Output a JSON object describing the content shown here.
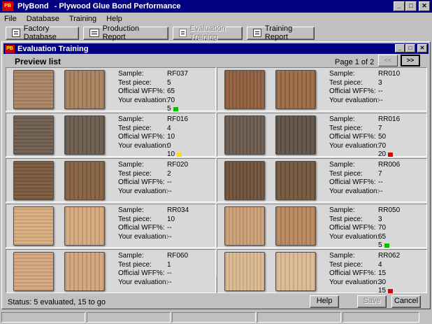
{
  "app": {
    "icon_text": "PB",
    "title_name": "PlyBond",
    "title_rest": "- Plywood Glue Bond Performance"
  },
  "window_buttons": {
    "minimize": "_",
    "maximize": "□",
    "close": "✕"
  },
  "menu": [
    "File",
    "Database",
    "Training",
    "Help"
  ],
  "toolbar": [
    {
      "label": "Factory Database",
      "icon": "database-icon",
      "disabled": false
    },
    {
      "label": "Production Report",
      "icon": "report-icon",
      "disabled": false
    },
    {
      "label": "Evaluation Training",
      "icon": "training-icon",
      "disabled": true
    },
    {
      "label": "Training Report",
      "icon": "printer-icon",
      "disabled": false
    }
  ],
  "child_window": {
    "icon_text": "PB",
    "title": "Evaluation Training",
    "preview_label": "Preview list",
    "page_indicator": "Page 1 of 2",
    "prev_label": "<<",
    "next_label": ">>"
  },
  "field_labels": {
    "sample": "Sample:",
    "test_piece": "Test piece:",
    "official_wff": "Official WFF%:",
    "your_evaluation": "Your evaluation:"
  },
  "cards": [
    {
      "sample": "RF037",
      "test_piece": "5",
      "official_wff": "65",
      "your_evaluation": "70",
      "score": "5",
      "indicator_color": "#00c000",
      "wood_a": "#a98461",
      "wood_b": "#a67f5c"
    },
    {
      "sample": "RR010",
      "test_piece": "3",
      "official_wff": "--",
      "your_evaluation": "--",
      "score": "",
      "indicator_color": "",
      "wood_a": "#8f5e3d",
      "wood_b": "#9a6a45"
    },
    {
      "sample": "RF016",
      "test_piece": "4",
      "official_wff": "10",
      "your_evaluation": "0",
      "score": "10",
      "indicator_color": "#ffe000",
      "wood_a": "#6e5e4e",
      "wood_b": "#6a5a4a"
    },
    {
      "sample": "RR016",
      "test_piece": "7",
      "official_wff": "50",
      "your_evaluation": "70",
      "score": "20",
      "indicator_color": "#e00000",
      "wood_a": "#6a5a4c",
      "wood_b": "#5e5044"
    },
    {
      "sample": "RF020",
      "test_piece": "2",
      "official_wff": "--",
      "your_evaluation": "--",
      "score": "",
      "indicator_color": "",
      "wood_a": "#7b5a3c",
      "wood_b": "#85603f"
    },
    {
      "sample": "RR006",
      "test_piece": "7",
      "official_wff": "--",
      "your_evaluation": "--",
      "score": "",
      "indicator_color": "",
      "wood_a": "#6e5038",
      "wood_b": "#73563d"
    },
    {
      "sample": "RR034",
      "test_piece": "10",
      "official_wff": "--",
      "your_evaluation": "--",
      "score": "",
      "indicator_color": "",
      "wood_a": "#d8ad7e",
      "wood_b": "#d4a77a"
    },
    {
      "sample": "RR050",
      "test_piece": "3",
      "official_wff": "70",
      "your_evaluation": "65",
      "score": "5",
      "indicator_color": "#00c000",
      "wood_a": "#c99e74",
      "wood_b": "#b8875c"
    },
    {
      "sample": "RF060",
      "test_piece": "1",
      "official_wff": "--",
      "your_evaluation": "--",
      "score": "",
      "indicator_color": "",
      "wood_a": "#d3a67e",
      "wood_b": "#d0a27a"
    },
    {
      "sample": "RR062",
      "test_piece": "4",
      "official_wff": "15",
      "your_evaluation": "30",
      "score": "15",
      "indicator_color": "#e00000",
      "wood_a": "#dab78f",
      "wood_b": "#dcba95"
    }
  ],
  "status": "Status: 5 evaluated, 15 to go",
  "bottom_buttons": {
    "help": "Help",
    "save": "Save",
    "cancel": "Cancel"
  }
}
